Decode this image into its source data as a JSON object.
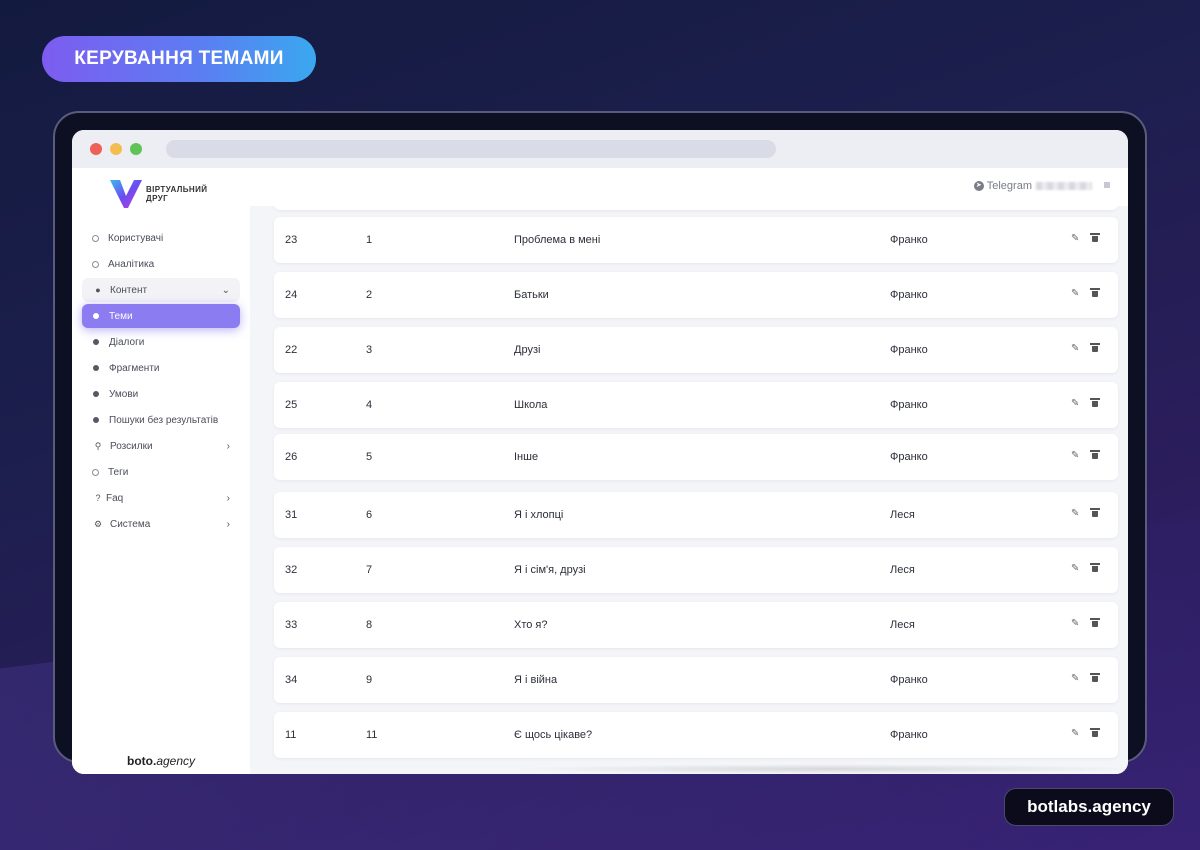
{
  "banner": {
    "title": "КЕРУВАННЯ ТЕМАМИ"
  },
  "brand": {
    "label": "botlabs.agency"
  },
  "app": {
    "logo_text": "ВІРТУАЛЬНИЙ ДРУГ",
    "footer_bold": "boto.",
    "footer_rest": "agency"
  },
  "topbar": {
    "telegram_label": "Telegram"
  },
  "sidebar": {
    "items": [
      {
        "label": "Користувачі"
      },
      {
        "label": "Аналітика"
      },
      {
        "label": "Контент"
      },
      {
        "label": "Теми"
      },
      {
        "label": "Діалоги"
      },
      {
        "label": "Фрагменти"
      },
      {
        "label": "Умови"
      },
      {
        "label": "Пошуки без результатів"
      },
      {
        "label": "Розсилки"
      },
      {
        "label": "Теги"
      },
      {
        "label": "Faq"
      },
      {
        "label": "Система"
      }
    ]
  },
  "topics": {
    "rows": [
      {
        "id": "23",
        "num": "1",
        "name": "Проблема в мені",
        "author": "Франко"
      },
      {
        "id": "24",
        "num": "2",
        "name": "Батьки",
        "author": "Франко"
      },
      {
        "id": "22",
        "num": "3",
        "name": "Друзі",
        "author": "Франко"
      },
      {
        "id": "25",
        "num": "4",
        "name": "Школа",
        "author": "Франко"
      },
      {
        "id": "26",
        "num": "5",
        "name": "Інше",
        "author": "Франко"
      },
      {
        "id": "31",
        "num": "6",
        "name": "Я і хлопці",
        "author": "Леся"
      },
      {
        "id": "32",
        "num": "7",
        "name": "Я і сім'я, друзі",
        "author": "Леся"
      },
      {
        "id": "33",
        "num": "8",
        "name": "Хто я?",
        "author": "Леся"
      },
      {
        "id": "34",
        "num": "9",
        "name": "Я і війна",
        "author": "Франко"
      },
      {
        "id": "11",
        "num": "11",
        "name": "Є щось цікаве?",
        "author": "Франко"
      }
    ]
  },
  "colors": {
    "accent": "#8b7cf2",
    "banner_gradient_start": "#7d5cf0",
    "banner_gradient_end": "#3aa8ef"
  }
}
